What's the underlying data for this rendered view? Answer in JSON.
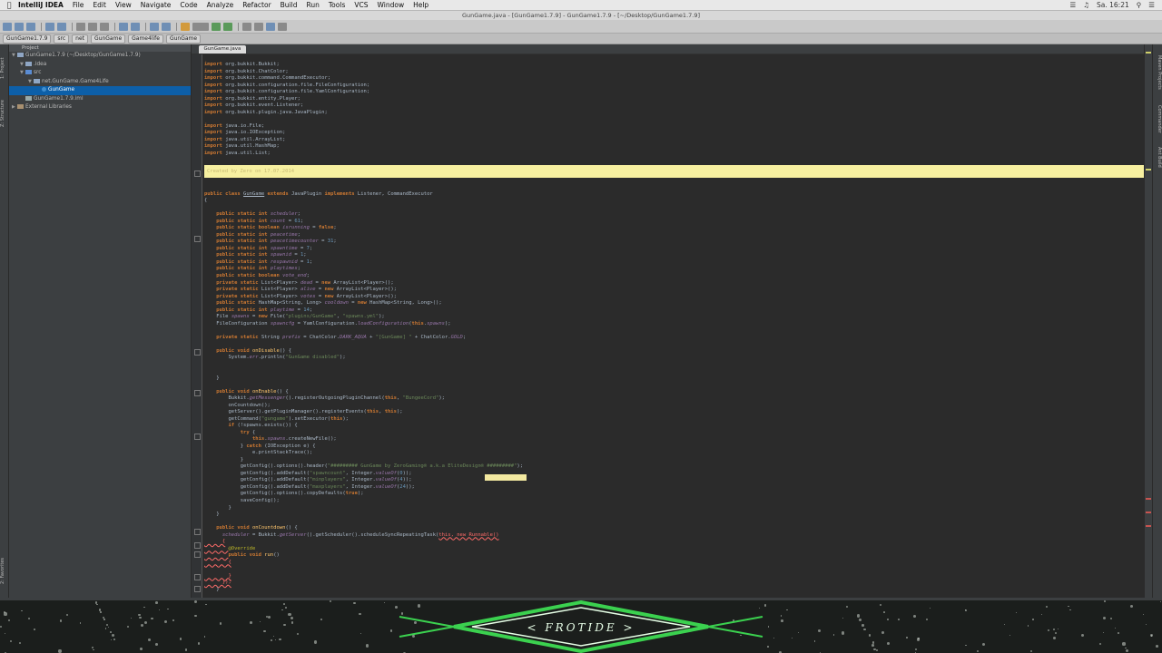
{
  "menubar": {
    "app_name": "IntelliJ IDEA",
    "items": [
      "File",
      "Edit",
      "View",
      "Navigate",
      "Code",
      "Analyze",
      "Refactor",
      "Build",
      "Run",
      "Tools",
      "VCS",
      "Window",
      "Help"
    ],
    "clock": "Sa. 16:21"
  },
  "window": {
    "title": "GunGame.java - [GunGame1.7.9] - GunGame1.7.9 - [~/Desktop/GunGame1.7.9]"
  },
  "navbar": {
    "crumbs": [
      "GunGame1.7.9",
      "src",
      "net",
      "GunGame",
      "Game4life",
      "GunGame"
    ]
  },
  "leftstrip": {
    "tab1": "1: Project",
    "tab2": "Z: Structure",
    "tab3": "2: Favorites"
  },
  "rightstrip": {
    "tab1": "Maven Projects",
    "tab2": "Commander",
    "tab3": "Ant Build"
  },
  "project": {
    "header": "Project",
    "rows": [
      {
        "label": "GunGame1.7.9 (~/Desktop/GunGame1.7.9)",
        "indent": 0,
        "type": "folder",
        "selected": false
      },
      {
        "label": ".idea",
        "indent": 1,
        "type": "folder",
        "selected": false
      },
      {
        "label": "src",
        "indent": 1,
        "type": "src",
        "selected": false
      },
      {
        "label": "net.GunGame.Game4Life",
        "indent": 2,
        "type": "folder",
        "selected": false
      },
      {
        "label": "GunGame",
        "indent": 3,
        "type": "java",
        "selected": true
      },
      {
        "label": "GunGame1.7.9.iml",
        "indent": 1,
        "type": "file",
        "selected": false
      },
      {
        "label": "External Libraries",
        "indent": 0,
        "type": "lib",
        "selected": false
      }
    ]
  },
  "editor": {
    "tab_label": "GunGame.java",
    "highlight_text": "Created by Zero on 17.07.2014",
    "lines": [
      [
        [
          "kw",
          "import "
        ],
        [
          "cls",
          "org.bukkit.Bukkit;"
        ]
      ],
      [
        [
          "kw",
          "import "
        ],
        [
          "cls",
          "org.bukkit.ChatColor;"
        ]
      ],
      [
        [
          "kw",
          "import "
        ],
        [
          "cls",
          "org.bukkit.command.CommandExecutor;"
        ]
      ],
      [
        [
          "kw",
          "import "
        ],
        [
          "cls",
          "org.bukkit.configuration.file.FileConfiguration;"
        ]
      ],
      [
        [
          "kw",
          "import "
        ],
        [
          "cls",
          "org.bukkit.configuration.file.YamlConfiguration;"
        ]
      ],
      [
        [
          "kw",
          "import "
        ],
        [
          "cls",
          "org.bukkit.entity.Player;"
        ]
      ],
      [
        [
          "kw",
          "import "
        ],
        [
          "cls",
          "org.bukkit.event.Listener;"
        ]
      ],
      [
        [
          "kw",
          "import "
        ],
        [
          "cls",
          "org.bukkit.plugin.java.JavaPlugin;"
        ]
      ],
      [],
      [
        [
          "kw",
          "import "
        ],
        [
          "cls",
          "java.io.File;"
        ]
      ],
      [
        [
          "kw",
          "import "
        ],
        [
          "cls",
          "java.io.IOException;"
        ]
      ],
      [
        [
          "kw",
          "import "
        ],
        [
          "cls",
          "java.util.ArrayList;"
        ]
      ],
      [
        [
          "kw",
          "import "
        ],
        [
          "cls",
          "java.util.HashMap;"
        ]
      ],
      [
        [
          "kw",
          "import "
        ],
        [
          "cls",
          "java.util.List;"
        ]
      ],
      [],
      [],
      [],
      [],
      [],
      [
        [
          "kw",
          "public class "
        ],
        [
          "ul",
          "GunGame"
        ],
        [
          "kw",
          " extends "
        ],
        [
          "cls",
          "JavaPlugin "
        ],
        [
          "kw",
          "implements "
        ],
        [
          "cls",
          "Listener, CommandExecutor"
        ]
      ],
      [
        [
          "cls",
          "{"
        ]
      ],
      [],
      [
        [
          "cls",
          "    "
        ],
        [
          "kw",
          "public static int "
        ],
        [
          "fld",
          "scheduler"
        ],
        [
          "cls",
          ";"
        ]
      ],
      [
        [
          "cls",
          "    "
        ],
        [
          "kw",
          "public static int "
        ],
        [
          "fld",
          "count"
        ],
        [
          "cls",
          " = "
        ],
        [
          "num",
          "61"
        ],
        [
          "cls",
          ";"
        ]
      ],
      [
        [
          "cls",
          "    "
        ],
        [
          "kw",
          "public static boolean "
        ],
        [
          "fld",
          "isrunning"
        ],
        [
          "cls",
          " = "
        ],
        [
          "kw",
          "false"
        ],
        [
          "cls",
          ";"
        ]
      ],
      [
        [
          "cls",
          "    "
        ],
        [
          "kw",
          "public static int "
        ],
        [
          "fld",
          "peacetime"
        ],
        [
          "cls",
          ";"
        ]
      ],
      [
        [
          "cls",
          "    "
        ],
        [
          "kw",
          "public static int "
        ],
        [
          "fld",
          "peacetimecounter"
        ],
        [
          "cls",
          " = "
        ],
        [
          "num",
          "31"
        ],
        [
          "cls",
          ";"
        ]
      ],
      [
        [
          "cls",
          "    "
        ],
        [
          "kw",
          "public static int "
        ],
        [
          "fld",
          "spawntime"
        ],
        [
          "cls",
          " = "
        ],
        [
          "num",
          "7"
        ],
        [
          "cls",
          ";"
        ]
      ],
      [
        [
          "cls",
          "    "
        ],
        [
          "kw",
          "public static int "
        ],
        [
          "fld",
          "spawnid"
        ],
        [
          "cls",
          " = "
        ],
        [
          "num",
          "1"
        ],
        [
          "cls",
          ";"
        ]
      ],
      [
        [
          "cls",
          "    "
        ],
        [
          "kw",
          "public static int "
        ],
        [
          "fld",
          "respawnid"
        ],
        [
          "cls",
          " = "
        ],
        [
          "num",
          "1"
        ],
        [
          "cls",
          ";"
        ]
      ],
      [
        [
          "cls",
          "    "
        ],
        [
          "kw",
          "public static int "
        ],
        [
          "fld",
          "playtimes"
        ],
        [
          "cls",
          ";"
        ]
      ],
      [
        [
          "cls",
          "    "
        ],
        [
          "kw",
          "public static boolean "
        ],
        [
          "fld",
          "vote_end"
        ],
        [
          "cls",
          ";"
        ]
      ],
      [
        [
          "cls",
          "    "
        ],
        [
          "kw",
          "private static "
        ],
        [
          "cls",
          "List<Player> "
        ],
        [
          "fld",
          "dead"
        ],
        [
          "cls",
          " = "
        ],
        [
          "kw",
          "new "
        ],
        [
          "cls",
          "ArrayList<Player>();"
        ]
      ],
      [
        [
          "cls",
          "    "
        ],
        [
          "kw",
          "private static "
        ],
        [
          "cls",
          "List<Player> "
        ],
        [
          "fld",
          "alive"
        ],
        [
          "cls",
          " = "
        ],
        [
          "kw",
          "new "
        ],
        [
          "cls",
          "ArrayList<Player>();"
        ]
      ],
      [
        [
          "cls",
          "    "
        ],
        [
          "kw",
          "private static "
        ],
        [
          "cls",
          "List<Player> "
        ],
        [
          "fld",
          "votes"
        ],
        [
          "cls",
          " = "
        ],
        [
          "kw",
          "new "
        ],
        [
          "cls",
          "ArrayList<Player>();"
        ]
      ],
      [
        [
          "cls",
          "    "
        ],
        [
          "kw",
          "public static "
        ],
        [
          "cls",
          "HashMap<String, Long> "
        ],
        [
          "fld",
          "cooldown"
        ],
        [
          "cls",
          " = "
        ],
        [
          "kw",
          "new "
        ],
        [
          "cls",
          "HashMap<String, Long>();"
        ]
      ],
      [
        [
          "cls",
          "    "
        ],
        [
          "kw",
          "public static int "
        ],
        [
          "fld",
          "playtime"
        ],
        [
          "cls",
          " = "
        ],
        [
          "num",
          "14"
        ],
        [
          "cls",
          ";"
        ]
      ],
      [
        [
          "cls",
          "    File "
        ],
        [
          "fld",
          "spawns"
        ],
        [
          "cls",
          " = "
        ],
        [
          "kw",
          "new "
        ],
        [
          "cls",
          "File("
        ],
        [
          "str",
          "\"plugins/GunGame\""
        ],
        [
          "cls",
          ", "
        ],
        [
          "str",
          "\"spawns.yml\""
        ],
        [
          "cls",
          ");"
        ]
      ],
      [
        [
          "cls",
          "    FileConfiguration "
        ],
        [
          "fld",
          "spawncfg"
        ],
        [
          "cls",
          " = YamlConfiguration."
        ],
        [
          "fld",
          "loadConfiguration"
        ],
        [
          "cls",
          "("
        ],
        [
          "kw",
          "this"
        ],
        [
          "cls",
          "."
        ],
        [
          "fld",
          "spawns"
        ],
        [
          "cls",
          ");"
        ]
      ],
      [],
      [
        [
          "cls",
          "    "
        ],
        [
          "kw",
          "private static "
        ],
        [
          "cls",
          "String "
        ],
        [
          "fld",
          "prefix"
        ],
        [
          "cls",
          " = ChatColor."
        ],
        [
          "fld",
          "DARK_AQUA"
        ],
        [
          "cls",
          " + "
        ],
        [
          "str",
          "\"[GunGame] \""
        ],
        [
          "cls",
          " + ChatColor."
        ],
        [
          "fld",
          "GOLD"
        ],
        [
          "cls",
          ";"
        ]
      ],
      [],
      [
        [
          "cls",
          "    "
        ],
        [
          "kw",
          "public void "
        ],
        [
          "fnc",
          "onDisable"
        ],
        [
          "cls",
          "() {"
        ]
      ],
      [
        [
          "cls",
          "        System."
        ],
        [
          "fld",
          "err"
        ],
        [
          "cls",
          ".println("
        ],
        [
          "str",
          "\"GunGame disabled\""
        ],
        [
          "cls",
          ");"
        ]
      ],
      [],
      [],
      [
        [
          "cls",
          "    }"
        ]
      ],
      [],
      [
        [
          "cls",
          "    "
        ],
        [
          "kw",
          "public void "
        ],
        [
          "fnc",
          "onEnable"
        ],
        [
          "cls",
          "() {"
        ]
      ],
      [
        [
          "cls",
          "        Bukkit."
        ],
        [
          "fld",
          "getMessenger"
        ],
        [
          "cls",
          "().registerOutgoingPluginChannel("
        ],
        [
          "kw",
          "this"
        ],
        [
          "cls",
          ", "
        ],
        [
          "str",
          "\"BungeeCord\""
        ],
        [
          "cls",
          ");"
        ]
      ],
      [
        [
          "cls",
          "        onCountdown();"
        ]
      ],
      [
        [
          "cls",
          "        getServer().getPluginManager().registerEvents("
        ],
        [
          "kw",
          "this"
        ],
        [
          "cls",
          ", "
        ],
        [
          "kw",
          "this"
        ],
        [
          "cls",
          ");"
        ]
      ],
      [
        [
          "cls",
          "        getCommand("
        ],
        [
          "str",
          "\"gungame\""
        ],
        [
          "cls",
          ").setExecutor("
        ],
        [
          "kw",
          "this"
        ],
        [
          "cls",
          ");"
        ]
      ],
      [
        [
          "cls",
          "        "
        ],
        [
          "kw",
          "if "
        ],
        [
          "cls",
          "(!spawns.exists()) {"
        ]
      ],
      [
        [
          "cls",
          "            "
        ],
        [
          "kw",
          "try "
        ],
        [
          "cls",
          "{"
        ]
      ],
      [
        [
          "cls",
          "                "
        ],
        [
          "kw",
          "this"
        ],
        [
          "cls",
          "."
        ],
        [
          "fld",
          "spawns"
        ],
        [
          "cls",
          ".createNewFile();"
        ]
      ],
      [
        [
          "cls",
          "            } "
        ],
        [
          "kw",
          "catch "
        ],
        [
          "cls",
          "(IOException e) {"
        ]
      ],
      [
        [
          "cls",
          "                e.printStackTrace();"
        ]
      ],
      [
        [
          "cls",
          "            }"
        ]
      ],
      [
        [
          "cls",
          "            getConfig().options().header("
        ],
        [
          "str",
          "\"######### GunGame by ZeroGaming® a.k.a EliteDesign® #########\""
        ],
        [
          "cls",
          ");"
        ]
      ],
      [
        [
          "cls",
          "            getConfig().addDefault("
        ],
        [
          "str",
          "\"spawncount\""
        ],
        [
          "cls",
          ", Integer."
        ],
        [
          "fld",
          "valueOf"
        ],
        [
          "cls",
          "("
        ],
        [
          "num",
          "0"
        ],
        [
          "cls",
          "));"
        ]
      ],
      [
        [
          "cls",
          "            getConfig().addDefault("
        ],
        [
          "str",
          "\"minplayers\""
        ],
        [
          "cls",
          ", Integer."
        ],
        [
          "fld",
          "valueOf"
        ],
        [
          "cls",
          "("
        ],
        [
          "num",
          "4"
        ],
        [
          "cls",
          "));"
        ]
      ],
      [
        [
          "cls",
          "            getConfig().addDefault("
        ],
        [
          "str",
          "\"maxplayers\""
        ],
        [
          "cls",
          ", Integer."
        ],
        [
          "fld",
          "valueOf"
        ],
        [
          "cls",
          "("
        ],
        [
          "num",
          "24"
        ],
        [
          "cls",
          "));"
        ]
      ],
      [
        [
          "cls",
          "            getConfig().options().copyDefaults("
        ],
        [
          "kw",
          "true"
        ],
        [
          "cls",
          ");"
        ]
      ],
      [
        [
          "cls",
          "            saveConfig();"
        ]
      ],
      [
        [
          "cls",
          "        }"
        ]
      ],
      [
        [
          "cls",
          "    }"
        ]
      ],
      [],
      [
        [
          "cls",
          "    "
        ],
        [
          "kw",
          "public void "
        ],
        [
          "fnc",
          "onCountdown"
        ],
        [
          "cls",
          "() {"
        ]
      ],
      [
        [
          "cls",
          "      "
        ],
        [
          "fld",
          "scheduler"
        ],
        [
          "cls",
          " = Bukkit."
        ],
        [
          "fld",
          "getServer"
        ],
        [
          "cls",
          "().getScheduler().scheduleSyncRepeatingTask("
        ],
        [
          "err",
          "this, new Runnable()"
        ]
      ],
      [
        [
          "err",
          "      {"
        ]
      ],
      [
        [
          "err",
          "        "
        ],
        [
          "ann",
          "@Override"
        ]
      ],
      [
        [
          "err",
          "        "
        ],
        [
          "kw",
          "public void "
        ],
        [
          "fnc",
          "run"
        ],
        [
          "cls",
          "()"
        ]
      ],
      [
        [
          "err",
          "        {"
        ]
      ],
      [],
      [
        [
          "err",
          "        }"
        ]
      ],
      [
        [
          "err",
          "      });"
        ]
      ],
      [
        [
          "cls",
          "    }"
        ]
      ],
      [],
      [
        [
          "cls",
          "}"
        ]
      ]
    ]
  },
  "banner": {
    "text": "< FROTIDE >"
  },
  "colors": {
    "accent_selection": "#0d5fa8",
    "editor_bg": "#2b2b2b",
    "keyword": "#cc7832",
    "string": "#6a8759",
    "highlight": "#f7f0a0"
  }
}
